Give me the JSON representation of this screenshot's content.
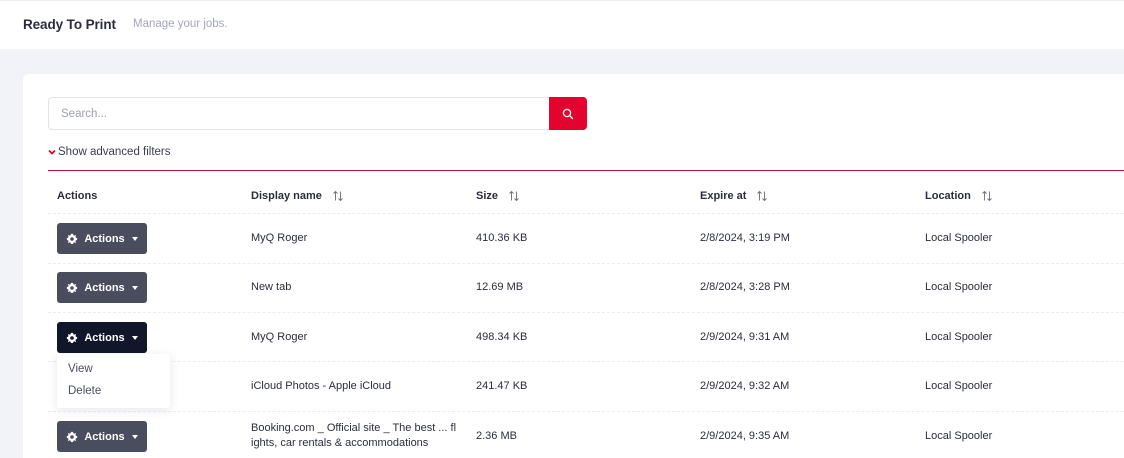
{
  "header": {
    "title": "Ready To Print",
    "subtitle": "Manage your jobs."
  },
  "search": {
    "placeholder": "Search...",
    "button_icon": "search-icon"
  },
  "filters": {
    "advanced_label": "Show advanced filters",
    "toggle_icon": "chevron-down-icon"
  },
  "table": {
    "columns": {
      "actions": "Actions",
      "display_name": "Display name",
      "size": "Size",
      "expire_at": "Expire at",
      "location": "Location"
    },
    "action_button_label": "Actions",
    "rows": [
      {
        "display_name": "MyQ Roger",
        "size": "410.36 KB",
        "expire_at": "2/8/2024, 3:19 PM",
        "location": "Local Spooler"
      },
      {
        "display_name": "New tab",
        "size": "12.69 MB",
        "expire_at": "2/8/2024, 3:28 PM",
        "location": "Local Spooler"
      },
      {
        "display_name": "MyQ Roger",
        "size": "498.34 KB",
        "expire_at": "2/9/2024, 9:31 AM",
        "location": "Local Spooler"
      },
      {
        "display_name": "iCloud Photos - Apple iCloud",
        "size": "241.47 KB",
        "expire_at": "2/9/2024, 9:32 AM",
        "location": "Local Spooler"
      },
      {
        "display_name_line1": "Booking.com _ Official site _ The best ... fl",
        "display_name_line2": "ights, car rentals & accommodations",
        "size": "2.36 MB",
        "expire_at": "2/9/2024, 9:35 AM",
        "location": "Local Spooler"
      }
    ]
  },
  "dropdown": {
    "items": [
      "View",
      "Delete"
    ]
  },
  "colors": {
    "accent": "#e4032e",
    "action_button": "#4a4d5e",
    "action_button_active": "#12162b"
  }
}
